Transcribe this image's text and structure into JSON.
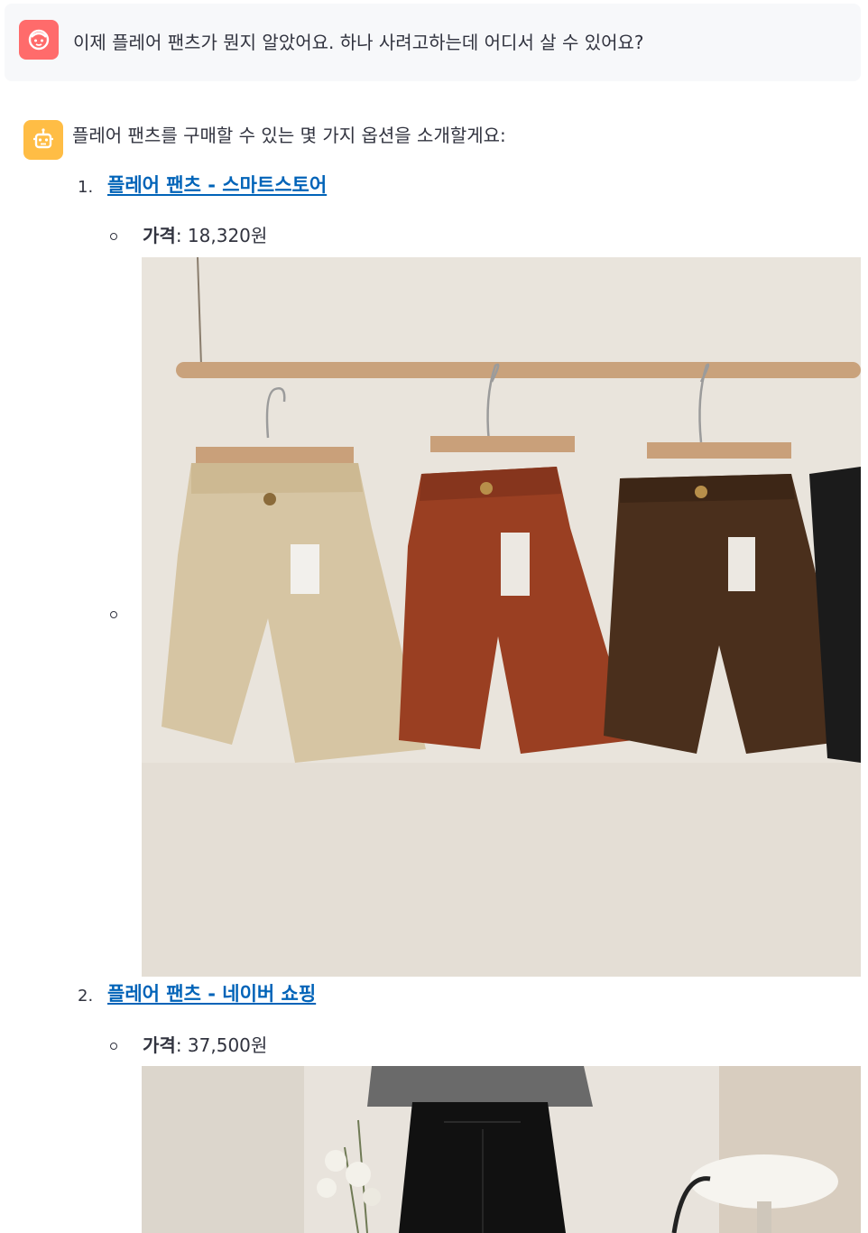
{
  "user_message": {
    "text": "이제 플레어 팬츠가 뭔지 알았어요. 하나 사려고하는데 어디서 살 수 있어요?"
  },
  "bot_message": {
    "intro": "플레어 팬츠를 구매할 수 있는 몇 가지 옵션을 소개할게요:",
    "options": [
      {
        "number": "1.",
        "link_text": "플레어 팬츠 - 스마트스토어",
        "price_label": "가격",
        "price_value": ": 18,320원",
        "image_alt": "corduroy shorts on hangers"
      },
      {
        "number": "2.",
        "link_text": "플레어 팬츠 - 네이버 쇼핑",
        "price_label": "가격",
        "price_value": ": 37,500원",
        "image_alt": "black flare pants"
      }
    ]
  },
  "colors": {
    "user_avatar": "#ff6b6b",
    "bot_avatar": "#ffbd45",
    "link": "#0063b8"
  }
}
